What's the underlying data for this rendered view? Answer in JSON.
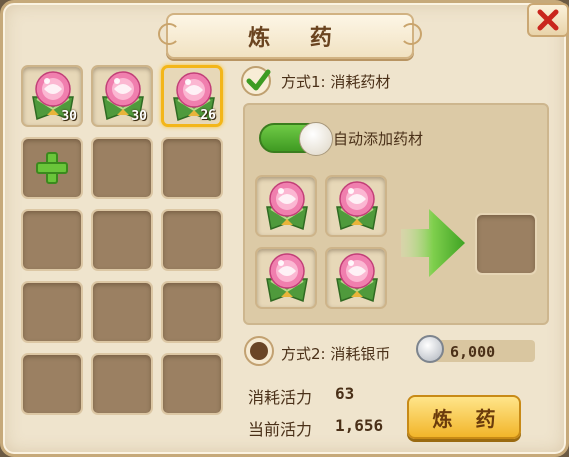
{
  "window": {
    "title": "炼 药",
    "close_icon": "close-x-icon"
  },
  "inventory": {
    "items": [
      {
        "icon": "pink-pill-herb-icon",
        "count": "30",
        "selected": false
      },
      {
        "icon": "pink-pill-herb-icon",
        "count": "30",
        "selected": false
      },
      {
        "icon": "pink-pill-herb-icon",
        "count": "26",
        "selected": true
      }
    ],
    "add_icon": "plus-icon",
    "empty_slots": 11
  },
  "method1": {
    "label": "方式1: 消耗药材",
    "checked": true,
    "auto_add_label": "自动添加药材",
    "auto_add_on": true,
    "ingredient_icon": "pink-pill-herb-icon",
    "ingredient_slots": 4,
    "arrow_icon": "green-arrow-right-icon"
  },
  "method2": {
    "label": "方式2: 消耗银币",
    "coin_icon": "silver-coin-icon",
    "coin_cost": "6,000"
  },
  "stats": {
    "consume_label": "消耗活力",
    "consume_value": "63",
    "current_label": "当前活力",
    "current_value": "1,656"
  },
  "action": {
    "refine_label": "炼 药"
  },
  "colors": {
    "accent_green": "#4fb22d",
    "button_gold": "#f2b52a",
    "panel_bg": "#efe4cd",
    "slot_bg": "#9b8062"
  }
}
